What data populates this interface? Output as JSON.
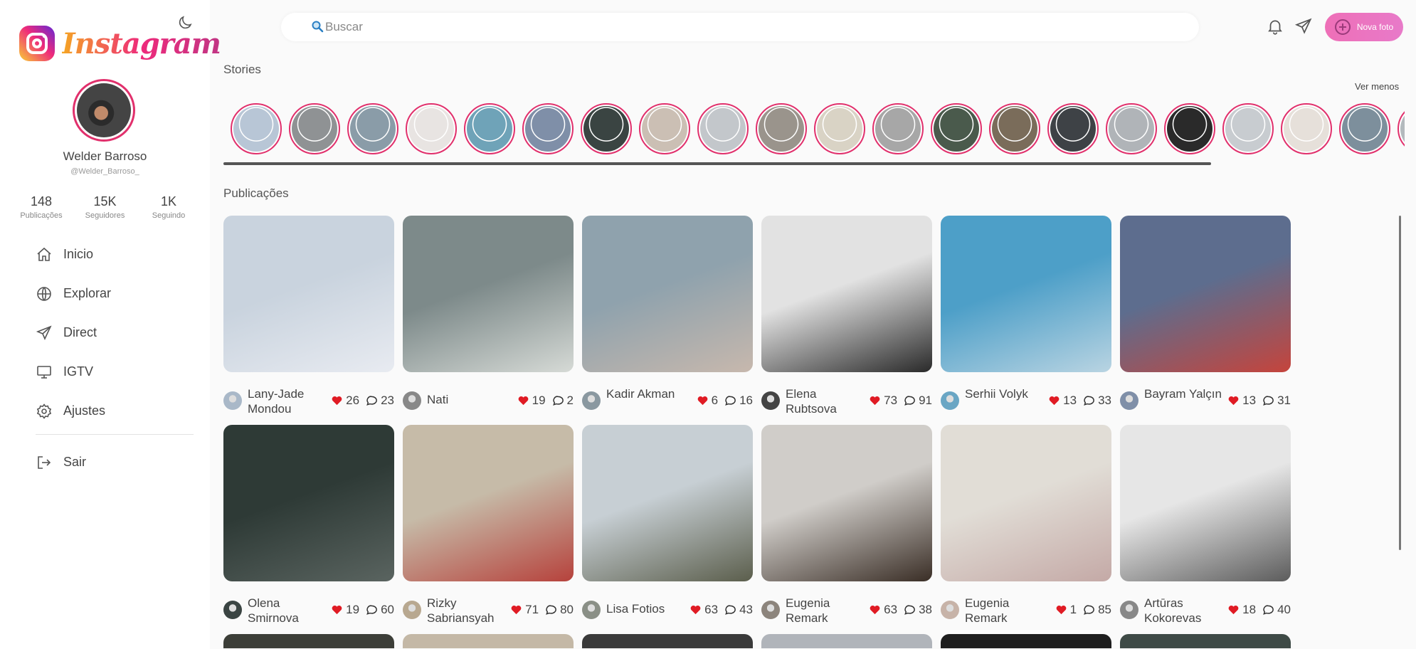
{
  "app": {
    "logo_text": "Instagram",
    "brand_colors": {
      "pink": "#e1306c",
      "orange": "#f5a623",
      "purple": "#c13584"
    }
  },
  "profile": {
    "name": "Welder Barroso",
    "handle": "@Welder_Barroso_",
    "stats": [
      {
        "value": "148",
        "label": "Publicações"
      },
      {
        "value": "15K",
        "label": "Seguidores"
      },
      {
        "value": "1K",
        "label": "Seguindo"
      }
    ]
  },
  "nav": {
    "items": [
      {
        "label": "Inicio",
        "icon": "home-icon"
      },
      {
        "label": "Explorar",
        "icon": "globe-icon"
      },
      {
        "label": "Direct",
        "icon": "send-icon"
      },
      {
        "label": "IGTV",
        "icon": "tv-icon"
      },
      {
        "label": "Ajustes",
        "icon": "gear-icon"
      }
    ],
    "exit_label": "Sair"
  },
  "topbar": {
    "search_placeholder": "Buscar",
    "new_photo_label": "Nova foto"
  },
  "stories": {
    "title": "Stories",
    "toggle_label": "Ver menos",
    "colors": [
      "#b8c6d6",
      "#8f9294",
      "#8a9ca8",
      "#e8e4e2",
      "#6fa3b8",
      "#7f8fa8",
      "#3a4442",
      "#cbbfb4",
      "#c3c7cb",
      "#9a948c",
      "#d9d3c5",
      "#a7a7a7",
      "#4a5a4c",
      "#7a6c5a",
      "#3e4246",
      "#b0b4b8",
      "#2a2a2a",
      "#c8ccd0",
      "#e6e0da",
      "#7d8f9c",
      "#b3b9bd"
    ]
  },
  "posts": {
    "title": "Publicações",
    "items": [
      {
        "author": "Lany-Jade Mondou",
        "likes": "26",
        "comments": "23",
        "colors": [
          "#c9d3de",
          "#e8ebf1"
        ],
        "avatar": "#a9b8c8"
      },
      {
        "author": "Nati",
        "likes": "19",
        "comments": "2",
        "colors": [
          "#7d8a8a",
          "#d6dad6"
        ],
        "avatar": "#888"
      },
      {
        "author": "Kadir Akman",
        "likes": "6",
        "comments": "16",
        "colors": [
          "#8fa2ad",
          "#c7b8ad"
        ],
        "avatar": "#8a98a0"
      },
      {
        "author": "Elena Rubtsova",
        "likes": "73",
        "comments": "91",
        "colors": [
          "#e2e2e2",
          "#2a2a2a"
        ],
        "avatar": "#444"
      },
      {
        "author": "Serhii Volyk",
        "likes": "13",
        "comments": "33",
        "colors": [
          "#4d9fc8",
          "#b9d4e2"
        ],
        "avatar": "#6aa6c4"
      },
      {
        "author": "Bayram Yalçın",
        "likes": "13",
        "comments": "31",
        "colors": [
          "#5d6d8e",
          "#c5443c"
        ],
        "avatar": "#7f8fa8"
      },
      {
        "author": "Olena Smirnova",
        "likes": "19",
        "comments": "60",
        "colors": [
          "#2e3a36",
          "#5a6460"
        ],
        "avatar": "#3a4442"
      },
      {
        "author": "Rizky Sabriansyah",
        "likes": "71",
        "comments": "80",
        "colors": [
          "#c6bba8",
          "#b6423c"
        ],
        "avatar": "#b8a890"
      },
      {
        "author": "Lisa Fotios",
        "likes": "63",
        "comments": "43",
        "colors": [
          "#c7cfd4",
          "#5b5e4c"
        ],
        "avatar": "#8a8f86"
      },
      {
        "author": "Eugenia Remark",
        "likes": "63",
        "comments": "38",
        "colors": [
          "#d0cdc9",
          "#3a2e26"
        ],
        "avatar": "#8c847c"
      },
      {
        "author": "Eugenia Remark",
        "likes": "1",
        "comments": "85",
        "colors": [
          "#e1ddd6",
          "#c4a9a6"
        ],
        "avatar": "#c7b3a8"
      },
      {
        "author": "Artūras Kokorevas",
        "likes": "18",
        "comments": "40",
        "colors": [
          "#e6e6e6",
          "#5c5c5c"
        ],
        "avatar": "#888"
      }
    ],
    "next_row_colors": [
      "#3c3e38",
      "#c4b8a6",
      "#3a3a3a",
      "#b0b4ba",
      "#1e1e1e",
      "#3e4a46"
    ],
    "heart_color": "#e01b24"
  }
}
